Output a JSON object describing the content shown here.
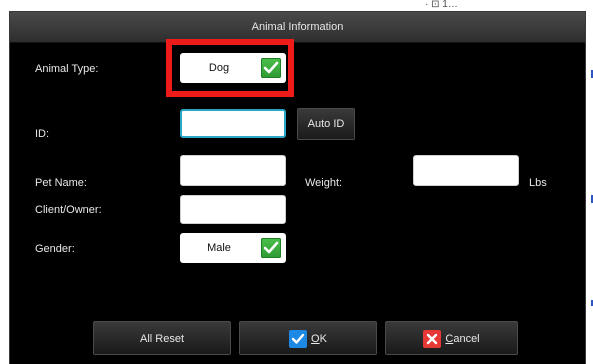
{
  "dialog": {
    "title": "Animal Information",
    "animal_type": {
      "label": "Animal Type:",
      "value": "Dog",
      "checked": true
    },
    "id": {
      "label": "ID:",
      "value": "",
      "auto_id_label": "Auto ID"
    },
    "pet_name": {
      "label": "Pet Name:",
      "value": ""
    },
    "weight": {
      "label": "Weight:",
      "value": "",
      "unit": "Lbs"
    },
    "client_owner": {
      "label": "Client/Owner:",
      "value": ""
    },
    "gender": {
      "label": "Gender:",
      "value": "Male",
      "checked": true
    },
    "buttons": {
      "all_reset": "All Reset",
      "ok_first": "O",
      "ok_rest": "K",
      "cancel_first": "C",
      "cancel_rest": "ancel"
    }
  },
  "background": {
    "partial_top_text": "· ⊡ 1…"
  },
  "colors": {
    "dialog_bg": "#000000",
    "accent_check": "#2e9a33",
    "focus_border": "#2aa7c8",
    "highlight": "#ee1b1b",
    "ok_icon": "#1e88e5",
    "cancel_icon": "#e53935"
  },
  "icons": {
    "check": "check-icon",
    "ok": "checkbox-checked-icon",
    "cancel": "close-x-icon"
  }
}
